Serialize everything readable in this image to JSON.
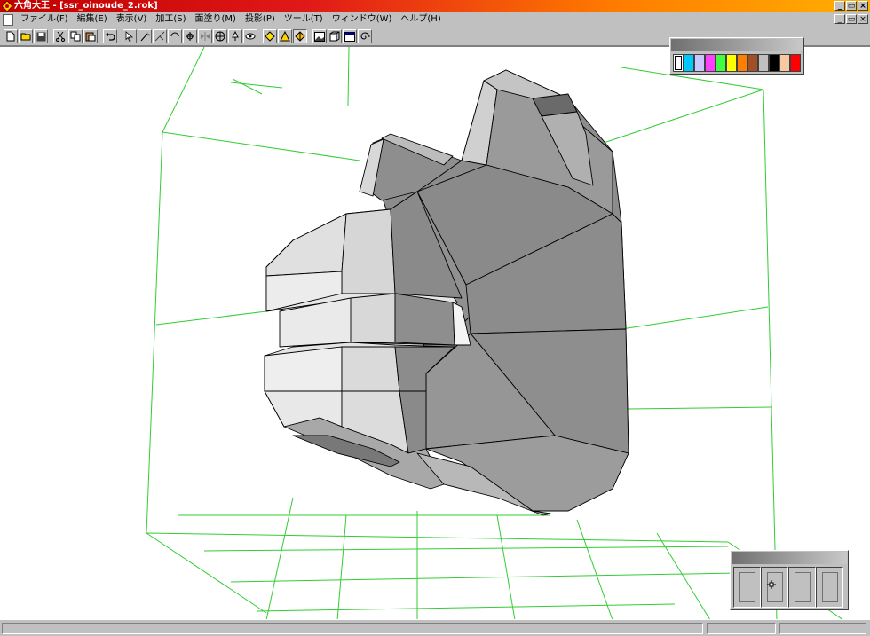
{
  "window": {
    "title": "六角大王 - [ssr_oinoude_2.rok]",
    "minimize": "_",
    "restore": "▭",
    "close": "×"
  },
  "menu": {
    "items": [
      "ファイル(F)",
      "編集(E)",
      "表示(V)",
      "加工(S)",
      "面塗り(M)",
      "投影(P)",
      "ツール(T)",
      "ウィンドウ(W)",
      "ヘルプ(H)"
    ]
  },
  "toolbar": {
    "icons": [
      "new-file-icon",
      "open-folder-icon",
      "save-icon",
      "cut-icon",
      "copy-icon",
      "paste-icon",
      "undo-icon",
      "select-arrow-icon",
      "magic-select-icon",
      "move-points-icon",
      "rotate-icon",
      "transform-icon",
      "mirror-icon",
      "move-view-icon",
      "dropper-icon",
      "eye-icon",
      "view-front-icon",
      "view-light-icon",
      "view-solid-icon",
      "image-icon",
      "box-icon",
      "window-icon",
      "spiral-icon"
    ]
  },
  "palette": {
    "colors": [
      "#ffffff",
      "#00c8ff",
      "#c8c8ff",
      "#ff40ff",
      "#40ff40",
      "#ffff00",
      "#ff8000",
      "#a05028",
      "#c0c0c0",
      "#000000",
      "#f8c8a0",
      "#ff0000",
      "#ffffff"
    ]
  },
  "colors": {
    "grid": "#33cc33",
    "model_dark": "#8c8c8c",
    "model_light": "#e4e4e4",
    "edge": "#000000"
  }
}
